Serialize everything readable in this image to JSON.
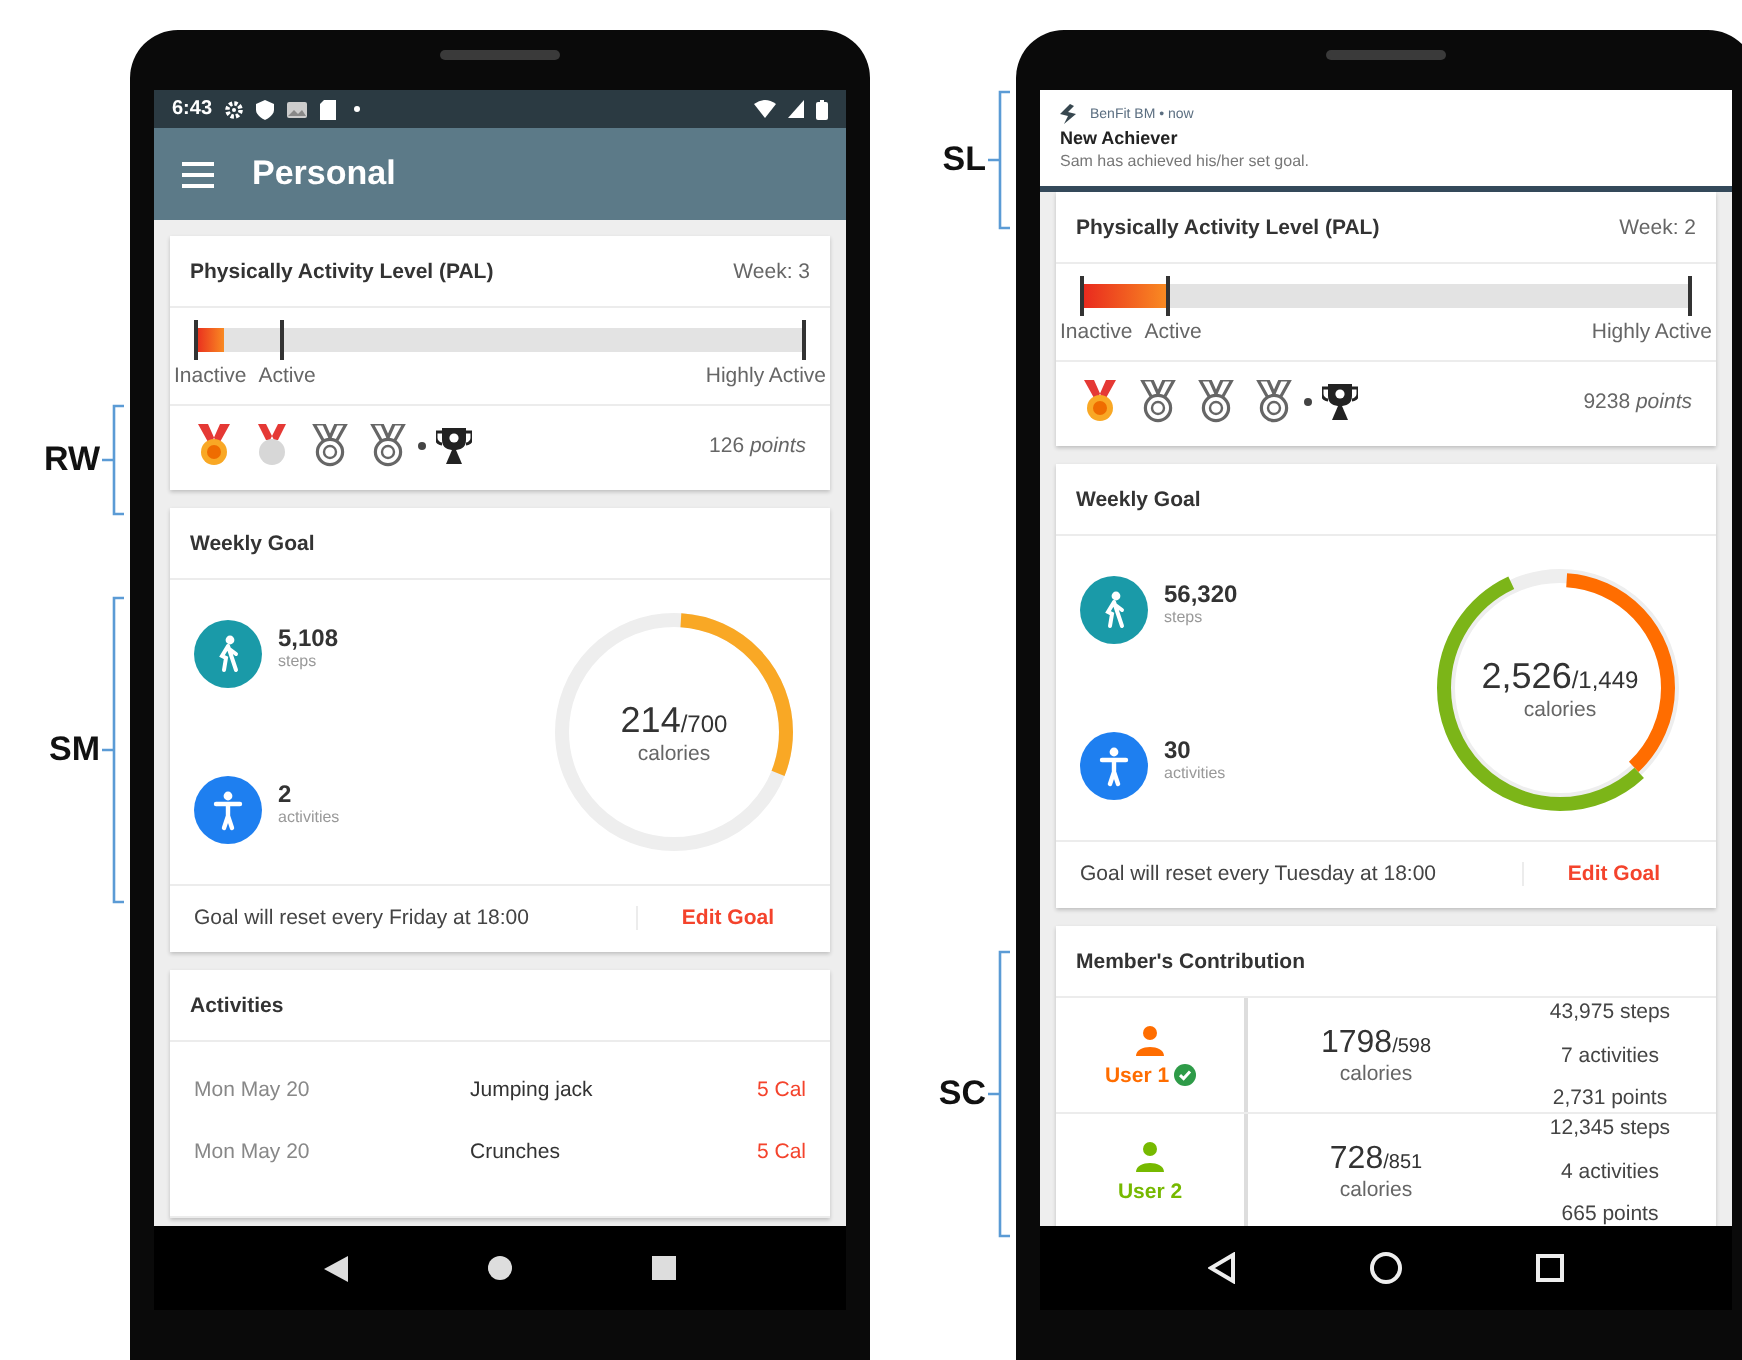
{
  "left_annotations": [
    "RW",
    "SM"
  ],
  "middle_annotations": [
    "SL",
    "SC"
  ],
  "phones": [
    {
      "nav_bar": {
        "kind": "filled"
      },
      "status_bar": {
        "time": "6:43"
      },
      "app_bar": {
        "title": "Personal"
      },
      "pal": {
        "title": "Physically Activity Level (PAL)",
        "week": "Week: 3",
        "level": 0.05,
        "scale": [
          "Inactive",
          "Active",
          "Highly Active"
        ]
      },
      "rewards": {
        "medals": [
          {
            "kind": "gold"
          },
          {
            "kind": "silver"
          },
          {
            "kind": "locked"
          },
          {
            "kind": "locked"
          }
        ],
        "points": "126 *points*"
      },
      "weekly_goal": {
        "title": "Weekly Goal",
        "steps": "5,108",
        "steps_label": "steps",
        "activities": "2",
        "activities_label": "activities",
        "calories": "214",
        "calories_goal": "/700",
        "calories_label": "calories",
        "ring": [
          {
            "color": "#f9a825",
            "level": 0.3
          }
        ],
        "reset_note": "Goal will reset every Friday at 18:00",
        "edit": "Edit Goal"
      },
      "activities": {
        "title": "Activities",
        "rows": [
          {
            "date": "Mon May 20",
            "name": "Jumping jack",
            "calories": "5 Cal"
          },
          {
            "date": "Mon May 20",
            "name": "Crunches",
            "calories": "5 Cal"
          }
        ]
      }
    },
    {
      "nav_bar": {
        "kind": "outline"
      },
      "notification": {
        "app": "BenFit BM • now",
        "title": "New Achiever",
        "body": "Sam has achieved his/her set goal."
      },
      "pal": {
        "title": "Physically Activity Level (PAL)",
        "week": "Week: 2",
        "level": 0.14,
        "scale": [
          "Inactive",
          "Active",
          "Highly Active"
        ]
      },
      "rewards": {
        "medals": [
          {
            "kind": "gold"
          },
          {
            "kind": "locked"
          },
          {
            "kind": "locked"
          },
          {
            "kind": "locked"
          }
        ],
        "points": "9238 *points*"
      },
      "weekly_goal": {
        "title": "Weekly Goal",
        "steps": "56,320",
        "steps_label": "steps",
        "activities": "30",
        "activities_label": "activities",
        "calories": "2,526",
        "calories_goal": "/1,449",
        "calories_label": "calories",
        "ring": [
          {
            "color": "#ff6d00",
            "level": 0.37
          },
          {
            "color": "#7cb518",
            "level": 0.55
          }
        ],
        "reset_note": "Goal will reset every Tuesday at 18:00",
        "edit": "Edit Goal"
      },
      "members": {
        "title": "Member's Contribution",
        "rows": [
          {
            "name": "User 1",
            "color": "#ff6d00",
            "verified": true,
            "calories": "1798",
            "calories_goal": "/598",
            "calories_label": "calories",
            "stats": [
              "43,975 steps",
              "7 activities",
              "2,731 points"
            ]
          },
          {
            "name": "User 2",
            "color": "#76b900",
            "verified": false,
            "calories": "728",
            "calories_goal": "/851",
            "calories_label": "calories",
            "stats": [
              "12,345 steps",
              "4 activities",
              "665 points"
            ]
          }
        ]
      }
    }
  ]
}
